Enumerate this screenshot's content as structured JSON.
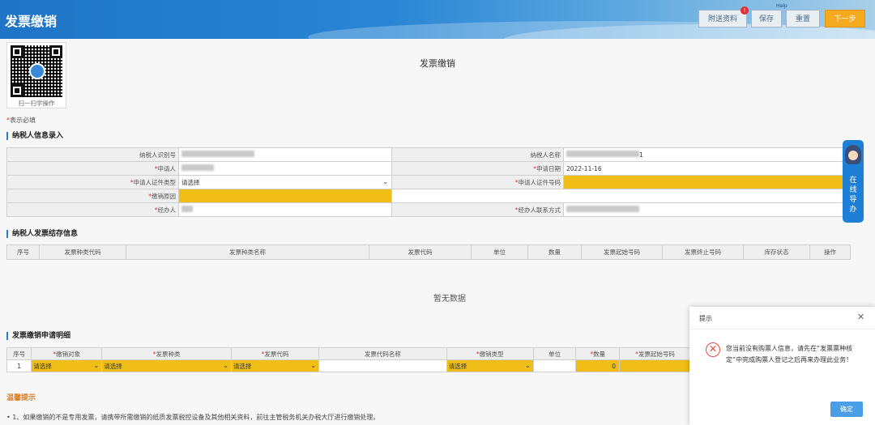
{
  "header": {
    "title": "发票缴销",
    "attach_label": "附送资料",
    "attach_badge": "!",
    "note": "Help",
    "save_label": "保存",
    "reset_label": "重置",
    "next_label": "下一步"
  },
  "qr": {
    "caption": "扫一扫学操作"
  },
  "page_title": "发票缴销",
  "required_note": {
    "star": "*",
    "text": "表示必填"
  },
  "sections": {
    "taxpayer": "纳税人信息录入",
    "stock": "纳税人发票结存信息",
    "apply": "发票缴销申请明细"
  },
  "form": {
    "taxpayer_id_label": "纳税人识别号",
    "taxpayer_name_label": "纳税人名称",
    "applicant_label": "申请人",
    "apply_date_label": "申请日期",
    "apply_date_value": "2022-11-16",
    "id_type_label": "申请人证件类型",
    "id_type_value": "请选择",
    "id_no_label": "申请人证件号码",
    "reason_label": "缴销原因",
    "handler_label": "经办人",
    "handler_phone_label": "经办人联系方式",
    "name_suffix": "1"
  },
  "stock_table": {
    "headers": [
      "序号",
      "发票种类代码",
      "发票种类名称",
      "发票代码",
      "单位",
      "数量",
      "发票起始号码",
      "发票终止号码",
      "库存状态",
      "操作"
    ],
    "empty_text": "暂无数据"
  },
  "apply_table": {
    "headers": [
      "序号",
      "缴销对象",
      "发票种类",
      "发票代码",
      "发票代码名称",
      "缴销类型",
      "单位",
      "数量",
      "发票起始号码"
    ],
    "required_cols": [
      false,
      true,
      true,
      true,
      false,
      true,
      false,
      true,
      true
    ],
    "row": {
      "index": "1",
      "target": "请选择",
      "kind": "请选择",
      "code": "请选择",
      "type": "请选择",
      "qty": "0"
    }
  },
  "tips": {
    "title": "温馨提示",
    "line1": "• 1、如果缴销的不是专用发票，请携带所需缴销的纸质发票税控设备及其他相关资料，前往主管税务机关办税大厅进行缴销处理。"
  },
  "guide": {
    "text": "在线导办"
  },
  "dialog": {
    "title": "提示",
    "message": "您当前没有购票人信息，请先在“发票票种核定”中完成购票人登记之后再来办理此业务！",
    "ok_label": "确定"
  }
}
